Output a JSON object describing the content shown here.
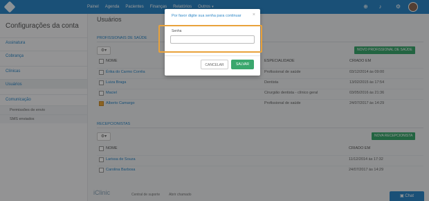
{
  "nav": {
    "items": [
      "Painel",
      "Agenda",
      "Pacientes",
      "Finanças",
      "Relatórios",
      "Outros"
    ]
  },
  "sidebar": {
    "title": "Configurações da conta",
    "items": [
      "Assinatura",
      "Cobrança",
      "Clínicas",
      "Usuários",
      "Comunicação"
    ],
    "subitems": [
      "Permissões de envio",
      "SMS enviados"
    ]
  },
  "main": {
    "title": "Usuários",
    "health": {
      "label": "PROFISSIONAIS DE SAÚDE",
      "new_button": "NOVO PROFISSIONAL DE SAÚDE",
      "columns": [
        "NOME",
        "ESPECIALIDADE",
        "CRIADO EM"
      ],
      "rows": [
        {
          "name": "Érika do Carmo Corrêa",
          "specialty": "Profissional de saúde",
          "created": "03/12/2014 às 09:00",
          "checked": false
        },
        {
          "name": "Luiza Braga",
          "specialty": "Dentista",
          "created": "13/02/2015 às 17:54",
          "checked": false
        },
        {
          "name": "Maciel",
          "specialty": "Cirurgião dentista - clínico geral",
          "created": "03/05/2016 às 21:36",
          "checked": false
        },
        {
          "name": "Alberto Camargo",
          "specialty": "Profissional de saúde",
          "created": "24/07/2017 às 14:29",
          "checked": true
        }
      ]
    },
    "reception": {
      "label": "RECEPCIONISTAS",
      "new_button": "NOVA RECEPCIONISTA",
      "columns": [
        "NOME",
        "CRIADO EM"
      ],
      "rows": [
        {
          "name": "Larissa de Souza",
          "created": "11/12/2014 às 17:32"
        },
        {
          "name": "Carolina Barbosa",
          "created": "24/07/2017 às 14:29"
        }
      ]
    }
  },
  "footer": {
    "brand": "iClinic",
    "links": [
      "Central de suporte",
      "Abrir chamado"
    ],
    "chat": "Chat"
  },
  "modal": {
    "title": "Por favor digite sua senha para continuar",
    "close": "×",
    "field_label": "Senha",
    "field_value": "",
    "cancel": "CANCELAR",
    "save": "SALVAR"
  },
  "colors": {
    "primary": "#2c86c6",
    "success": "#3aa76d",
    "highlight": "#e9a23b"
  }
}
